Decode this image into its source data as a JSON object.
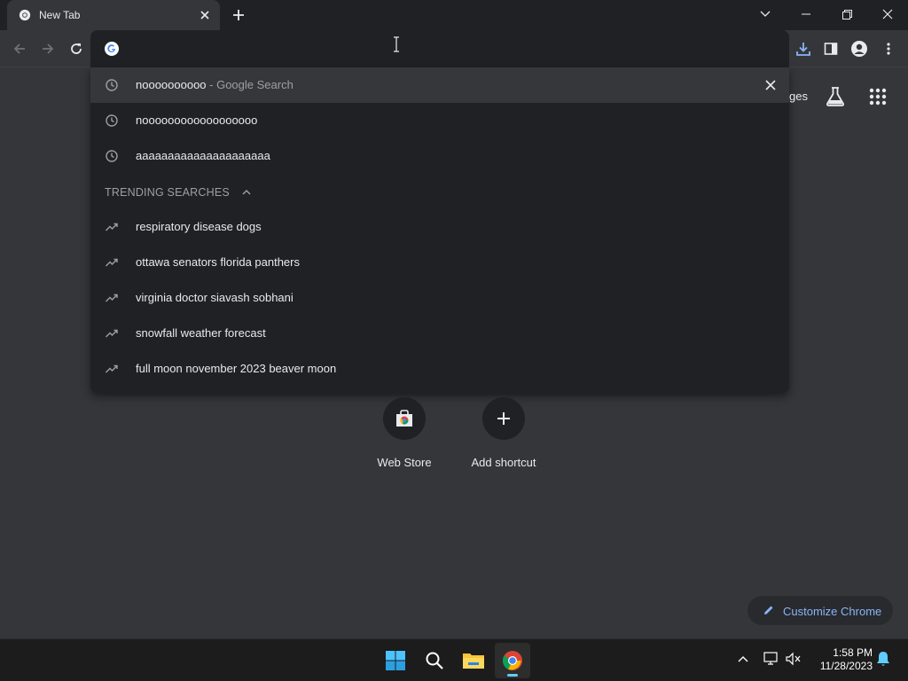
{
  "tab": {
    "title": "New Tab"
  },
  "omnibox": {
    "value": "",
    "placeholder": ""
  },
  "suggestions": [
    {
      "text": "noooooooooo",
      "suffix": " - Google Search",
      "type": "history"
    },
    {
      "text": "noooooooooooooooooo",
      "type": "history"
    },
    {
      "text": "aaaaaaaaaaaaaaaaaaaaa",
      "type": "history"
    }
  ],
  "trending": {
    "header": "TRENDING SEARCHES",
    "items": [
      "respiratory disease dogs",
      "ottawa senators florida panthers",
      "virginia doctor siavash sobhani",
      "snowfall weather forecast",
      "full moon november 2023 beaver moon"
    ]
  },
  "ntp": {
    "images_link_partial": "ges",
    "shortcuts": [
      {
        "label": "Web Store",
        "icon": "web-store-icon"
      },
      {
        "label": "Add shortcut",
        "icon": "plus-icon"
      }
    ],
    "customize_label": "Customize Chrome"
  },
  "taskbar": {
    "time": "1:58 PM",
    "date": "11/28/2023",
    "apps": [
      "windows-start-icon",
      "search-icon",
      "file-explorer-icon",
      "chrome-icon"
    ]
  },
  "colors": {
    "background": "#35363a",
    "omnibox": "#202124",
    "selected_row": "#36373a",
    "accent_blue": "#8ab4f8",
    "taskbar": "#1c1c1c"
  }
}
